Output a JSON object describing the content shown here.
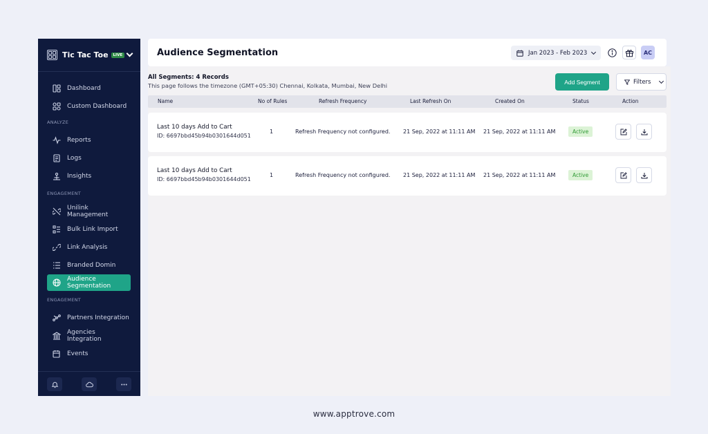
{
  "app": {
    "name": "Tic Tac Toe",
    "live_badge": "LIVE"
  },
  "sidebar": {
    "top_items": [
      {
        "label": "Dashboard",
        "icon": "dashboard-icon"
      },
      {
        "label": "Custom Dashboard",
        "icon": "custom-dashboard-icon"
      }
    ],
    "sections": [
      {
        "title": "ANALYZE",
        "items": [
          {
            "label": "Reports",
            "icon": "reports-icon"
          },
          {
            "label": "Logs",
            "icon": "logs-icon"
          },
          {
            "label": "Insights",
            "icon": "insights-icon"
          }
        ]
      },
      {
        "title": "ENGAGEMENT",
        "items": [
          {
            "label": "Unilink Management",
            "icon": "unilink-icon"
          },
          {
            "label": "Bulk Link Import",
            "icon": "bulk-import-icon"
          },
          {
            "label": "Link Analysis",
            "icon": "link-icon"
          },
          {
            "label": "Branded Domin",
            "icon": "branded-domain-icon"
          },
          {
            "label": "Audience Segmentation",
            "icon": "globe-icon",
            "active": true
          }
        ]
      },
      {
        "title": "ENGAGEMENT",
        "items": [
          {
            "label": "Partners Integration",
            "icon": "partners-icon"
          },
          {
            "label": "Agencies Integration",
            "icon": "agencies-icon"
          },
          {
            "label": "Events",
            "icon": "events-icon"
          }
        ]
      }
    ],
    "footer_icons": [
      "bell-icon",
      "cloud-icon",
      "more-icon"
    ]
  },
  "header": {
    "title": "Audience Segmentation",
    "date_range": "Jan 2023 - Feb 2023",
    "avatar_initials": "AC"
  },
  "main": {
    "summary": "All Segments: 4 Records",
    "timezone_note": "This page follows the timezone (GMT+05:30) Chennai, Kolkata, Mumbai, New Delhi",
    "add_button": "Add Segment",
    "filters_button": "Filters",
    "columns": [
      "Name",
      "No of Rules",
      "Refresh Frequency",
      "Last Refresh On",
      "Created On",
      "Status",
      "Action"
    ],
    "rows": [
      {
        "name": "Last 10 days Add to Cart",
        "id": "ID: 6697bbd45b94b0301644d051",
        "rules": "1",
        "refresh": "Refresh Frequency not configured.",
        "last_refresh": "21 Sep, 2022 at 11:11 AM",
        "created": "21 Sep, 2022 at 11:11 AM",
        "status": "Active"
      },
      {
        "name": "Last 10 days Add to Cart",
        "id": "ID: 6697bbd45b94b0301644d051",
        "rules": "1",
        "refresh": "Refresh Frequency not configured.",
        "last_refresh": "21 Sep, 2022 at 11:11 AM",
        "created": "21 Sep, 2022 at 11:11 AM",
        "status": "Active"
      }
    ]
  },
  "footer_url": "www.apptrove.com",
  "colors": {
    "sidebar_bg": "#0f1a3d",
    "accent": "#1fa488",
    "status_active_bg": "#dcf3d6",
    "status_active_text": "#2f9a34"
  }
}
